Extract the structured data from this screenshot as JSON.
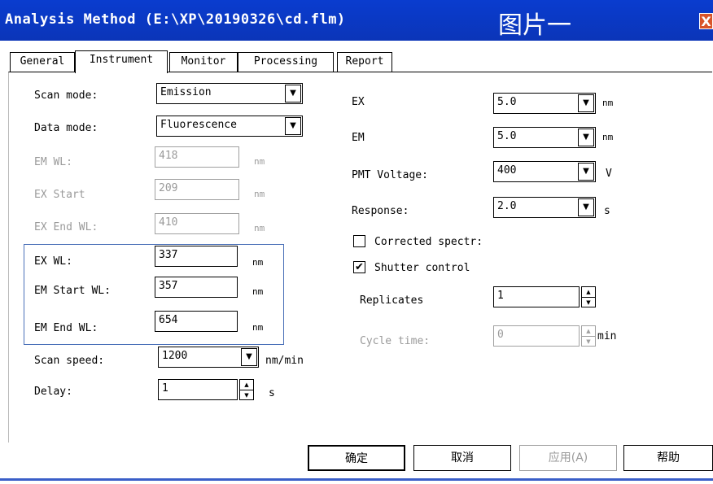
{
  "window": {
    "title": "Analysis Method (E:\\XP\\20190326\\cd.flm)",
    "annotation": "图片一",
    "close_glyph": "X"
  },
  "tabs": [
    "General",
    "Instrument",
    "Monitor",
    "Processing",
    "Report"
  ],
  "active_tab": "Instrument",
  "left": {
    "scan_mode": {
      "label": "Scan mode:",
      "value": "Emission"
    },
    "data_mode": {
      "label": "Data mode:",
      "value": "Fluorescence"
    },
    "em_wl": {
      "label": "EM WL:",
      "value": "418",
      "unit": "nm"
    },
    "ex_start": {
      "label": "EX Start",
      "value": "209",
      "unit": "nm"
    },
    "ex_end_wl": {
      "label": "EX End WL:",
      "value": "410",
      "unit": "nm"
    },
    "ex_wl": {
      "label": "EX WL:",
      "value": "337",
      "unit": "nm"
    },
    "em_start_wl": {
      "label": "EM Start WL:",
      "value": "357",
      "unit": "nm"
    },
    "em_end_wl": {
      "label": "EM End WL:",
      "value": "654",
      "unit": "nm"
    },
    "scan_speed": {
      "label": "Scan speed:",
      "value": "1200",
      "unit": "nm/min"
    },
    "delay": {
      "label": "Delay:",
      "value": "1",
      "unit": "s"
    }
  },
  "right": {
    "ex": {
      "label": "EX",
      "value": "5.0",
      "unit": "nm"
    },
    "em": {
      "label": "EM",
      "value": "5.0",
      "unit": "nm"
    },
    "pmt_voltage": {
      "label": "PMT Voltage:",
      "value": "400",
      "unit": "V"
    },
    "response": {
      "label": "Response:",
      "value": "2.0",
      "unit": "s"
    },
    "corrected_spectra": {
      "label": "Corrected spectr:",
      "checked": false
    },
    "shutter_control": {
      "label": "Shutter control",
      "checked": true,
      "mark": "✔"
    },
    "replicates": {
      "label": "Replicates",
      "value": "1"
    },
    "cycle_time": {
      "label": "Cycle time:",
      "value": "0",
      "unit": "min"
    }
  },
  "buttons": {
    "ok": "确定",
    "cancel": "取消",
    "apply": "应用(A)",
    "help": "帮助"
  },
  "colors": {
    "title_bar": "#0b35b8",
    "group_box_border": "#4a70b8",
    "disabled_text": "#9a9a9a"
  }
}
